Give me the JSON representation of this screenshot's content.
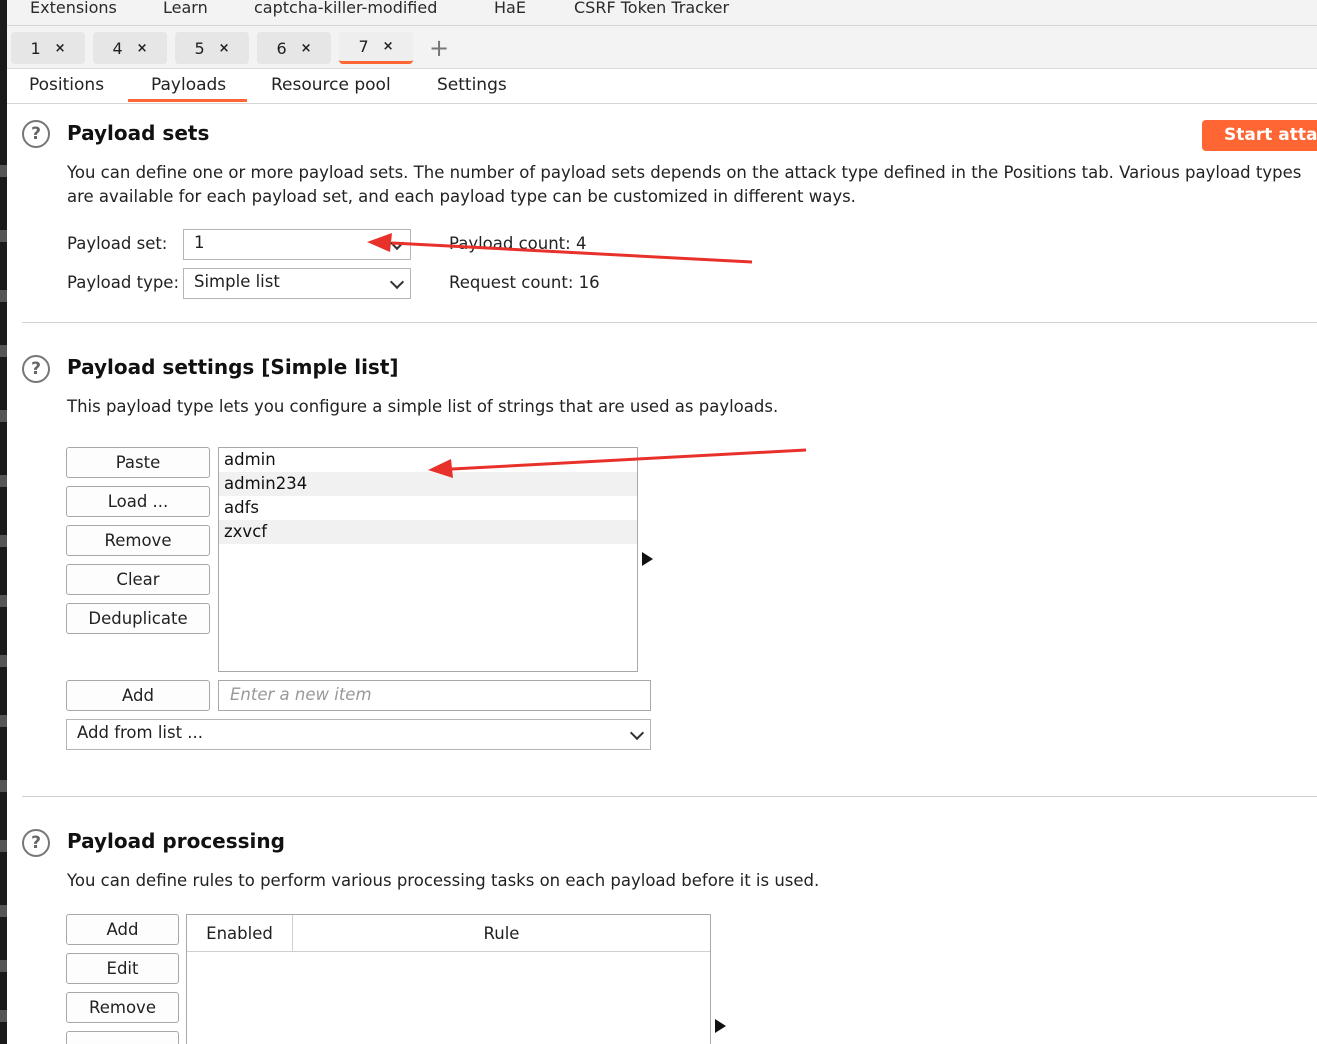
{
  "top_menu": [
    "Extensions",
    "Learn",
    "captcha-killer-modified",
    "HaE",
    "CSRF Token Tracker"
  ],
  "intruder_tabs": [
    {
      "label": "1",
      "close": "×"
    },
    {
      "label": "4",
      "close": "×"
    },
    {
      "label": "5",
      "close": "×"
    },
    {
      "label": "6",
      "close": "×"
    },
    {
      "label": "7",
      "close": "×",
      "active": true
    }
  ],
  "new_tab_label": "+",
  "sub_tabs": [
    "Positions",
    "Payloads",
    "Resource pool",
    "Settings"
  ],
  "active_sub_tab": "Payloads",
  "help_icon_glyph": "?",
  "payload_sets": {
    "title": "Payload sets",
    "start_attack_label": "Start attack",
    "description": "You can define one or more payload sets. The number of payload sets depends on the attack type defined in the Positions tab. Various payload types are available for each payload set, and each payload type can be customized in different ways.",
    "payload_set_label": "Payload set:",
    "payload_set_value": "1",
    "payload_type_label": "Payload type:",
    "payload_type_value": "Simple list",
    "payload_count_label": "Payload count:",
    "payload_count_value": "4",
    "request_count_label": "Request count:",
    "request_count_value": "16"
  },
  "payload_settings": {
    "title": "Payload settings [Simple list]",
    "description": "This payload type lets you configure a simple list of strings that are used as payloads.",
    "buttons": {
      "paste": "Paste",
      "load": "Load ...",
      "remove": "Remove",
      "clear": "Clear",
      "deduplicate": "Deduplicate",
      "add": "Add"
    },
    "items": [
      "admin",
      "admin234",
      "adfs",
      "zxvcf"
    ],
    "new_item_placeholder": "Enter a new item",
    "add_from_list_label": "Add from list ..."
  },
  "payload_processing": {
    "title": "Payload processing",
    "description": "You can define rules to perform various processing tasks on each payload before it is used.",
    "buttons": {
      "add": "Add",
      "edit": "Edit",
      "remove": "Remove"
    },
    "columns": [
      "Enabled",
      "Rule"
    ]
  },
  "colors": {
    "accent": "#ff6633",
    "annotation_arrow": "#e8312a"
  }
}
